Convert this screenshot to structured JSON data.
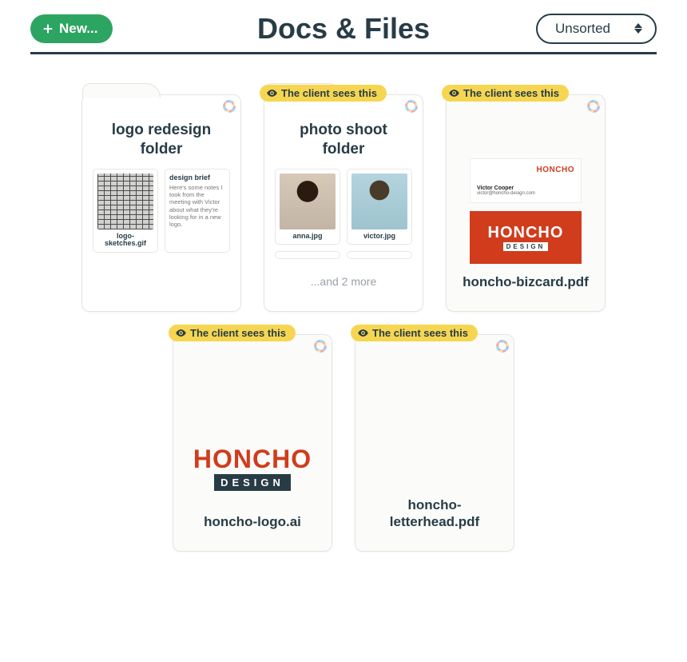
{
  "header": {
    "new_button_label": "New...",
    "title": "Docs & Files",
    "sort_label": "Unsorted"
  },
  "client_badge_text": "The client sees this",
  "items": [
    {
      "type": "folder",
      "title": "logo redesign folder",
      "client_visible": false,
      "previews": [
        {
          "kind": "image",
          "name": "logo-sketches.gif"
        },
        {
          "kind": "doc",
          "title": "design brief",
          "excerpt": "Here's some notes I took from the meeting with Victor about what they're looking for in a new logo."
        }
      ]
    },
    {
      "type": "folder",
      "title": "photo shoot folder",
      "client_visible": true,
      "previews": [
        {
          "kind": "image",
          "name": "anna.jpg"
        },
        {
          "kind": "image",
          "name": "victor.jpg"
        }
      ],
      "more_text": "...and 2 more"
    },
    {
      "type": "file",
      "name": "honcho-bizcard.pdf",
      "client_visible": true,
      "bizcard": {
        "brand": "HONCHO",
        "design_label": "DESIGN",
        "contact_name": "Victor Cooper",
        "contact_email": "victor@honcho-design.com"
      }
    },
    {
      "type": "file",
      "name": "honcho-logo.ai",
      "client_visible": true,
      "logo": {
        "brand": "HONCHO",
        "design_label": "DESIGN"
      }
    },
    {
      "type": "file",
      "name": "honcho-letterhead.pdf",
      "client_visible": true
    }
  ]
}
